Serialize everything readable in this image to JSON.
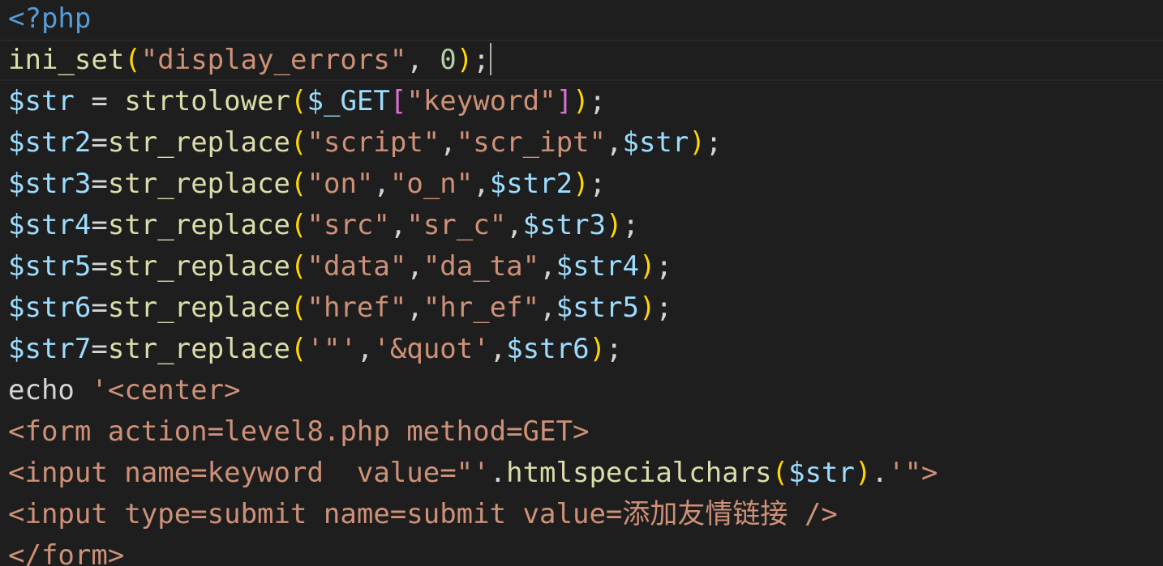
{
  "editor": {
    "colors": {
      "background": "#1e1e1e",
      "text": "#d4d4d4",
      "php_tag": "#569cd6",
      "function": "#dcdcaa",
      "variable": "#9cdcfe",
      "string": "#ce9178",
      "number": "#b5cea8",
      "bracket_gold": "#ffd700",
      "bracket_pink": "#da70d6",
      "current_line_border": "#282828",
      "cursor": "#aeafad"
    },
    "current_line_index": 1,
    "lines": [
      {
        "tokens": [
          {
            "t": "<?php",
            "c": "#569cd6"
          }
        ]
      },
      {
        "tokens": [
          {
            "t": "ini_set",
            "c": "#dcdcaa"
          },
          {
            "t": "(",
            "c": "#ffd700"
          },
          {
            "t": "\"display_errors\"",
            "c": "#ce9178"
          },
          {
            "t": ", ",
            "c": "#d4d4d4"
          },
          {
            "t": "0",
            "c": "#b5cea8"
          },
          {
            "t": ")",
            "c": "#ffd700"
          },
          {
            "t": ";",
            "c": "#d4d4d4"
          }
        ]
      },
      {
        "tokens": [
          {
            "t": "$str",
            "c": "#9cdcfe"
          },
          {
            "t": " = ",
            "c": "#d4d4d4"
          },
          {
            "t": "strtolower",
            "c": "#dcdcaa"
          },
          {
            "t": "(",
            "c": "#ffd700"
          },
          {
            "t": "$_GET",
            "c": "#9cdcfe"
          },
          {
            "t": "[",
            "c": "#da70d6"
          },
          {
            "t": "\"keyword\"",
            "c": "#ce9178"
          },
          {
            "t": "]",
            "c": "#da70d6"
          },
          {
            "t": ")",
            "c": "#ffd700"
          },
          {
            "t": ";",
            "c": "#d4d4d4"
          }
        ]
      },
      {
        "tokens": [
          {
            "t": "$str2",
            "c": "#9cdcfe"
          },
          {
            "t": "=",
            "c": "#d4d4d4"
          },
          {
            "t": "str_replace",
            "c": "#dcdcaa"
          },
          {
            "t": "(",
            "c": "#ffd700"
          },
          {
            "t": "\"script\"",
            "c": "#ce9178"
          },
          {
            "t": ",",
            "c": "#d4d4d4"
          },
          {
            "t": "\"scr_ipt\"",
            "c": "#ce9178"
          },
          {
            "t": ",",
            "c": "#d4d4d4"
          },
          {
            "t": "$str",
            "c": "#9cdcfe"
          },
          {
            "t": ")",
            "c": "#ffd700"
          },
          {
            "t": ";",
            "c": "#d4d4d4"
          }
        ]
      },
      {
        "tokens": [
          {
            "t": "$str3",
            "c": "#9cdcfe"
          },
          {
            "t": "=",
            "c": "#d4d4d4"
          },
          {
            "t": "str_replace",
            "c": "#dcdcaa"
          },
          {
            "t": "(",
            "c": "#ffd700"
          },
          {
            "t": "\"on\"",
            "c": "#ce9178"
          },
          {
            "t": ",",
            "c": "#d4d4d4"
          },
          {
            "t": "\"o_n\"",
            "c": "#ce9178"
          },
          {
            "t": ",",
            "c": "#d4d4d4"
          },
          {
            "t": "$str2",
            "c": "#9cdcfe"
          },
          {
            "t": ")",
            "c": "#ffd700"
          },
          {
            "t": ";",
            "c": "#d4d4d4"
          }
        ]
      },
      {
        "tokens": [
          {
            "t": "$str4",
            "c": "#9cdcfe"
          },
          {
            "t": "=",
            "c": "#d4d4d4"
          },
          {
            "t": "str_replace",
            "c": "#dcdcaa"
          },
          {
            "t": "(",
            "c": "#ffd700"
          },
          {
            "t": "\"src\"",
            "c": "#ce9178"
          },
          {
            "t": ",",
            "c": "#d4d4d4"
          },
          {
            "t": "\"sr_c\"",
            "c": "#ce9178"
          },
          {
            "t": ",",
            "c": "#d4d4d4"
          },
          {
            "t": "$str3",
            "c": "#9cdcfe"
          },
          {
            "t": ")",
            "c": "#ffd700"
          },
          {
            "t": ";",
            "c": "#d4d4d4"
          }
        ]
      },
      {
        "tokens": [
          {
            "t": "$str5",
            "c": "#9cdcfe"
          },
          {
            "t": "=",
            "c": "#d4d4d4"
          },
          {
            "t": "str_replace",
            "c": "#dcdcaa"
          },
          {
            "t": "(",
            "c": "#ffd700"
          },
          {
            "t": "\"data\"",
            "c": "#ce9178"
          },
          {
            "t": ",",
            "c": "#d4d4d4"
          },
          {
            "t": "\"da_ta\"",
            "c": "#ce9178"
          },
          {
            "t": ",",
            "c": "#d4d4d4"
          },
          {
            "t": "$str4",
            "c": "#9cdcfe"
          },
          {
            "t": ")",
            "c": "#ffd700"
          },
          {
            "t": ";",
            "c": "#d4d4d4"
          }
        ]
      },
      {
        "tokens": [
          {
            "t": "$str6",
            "c": "#9cdcfe"
          },
          {
            "t": "=",
            "c": "#d4d4d4"
          },
          {
            "t": "str_replace",
            "c": "#dcdcaa"
          },
          {
            "t": "(",
            "c": "#ffd700"
          },
          {
            "t": "\"href\"",
            "c": "#ce9178"
          },
          {
            "t": ",",
            "c": "#d4d4d4"
          },
          {
            "t": "\"hr_ef\"",
            "c": "#ce9178"
          },
          {
            "t": ",",
            "c": "#d4d4d4"
          },
          {
            "t": "$str5",
            "c": "#9cdcfe"
          },
          {
            "t": ")",
            "c": "#ffd700"
          },
          {
            "t": ";",
            "c": "#d4d4d4"
          }
        ]
      },
      {
        "tokens": [
          {
            "t": "$str7",
            "c": "#9cdcfe"
          },
          {
            "t": "=",
            "c": "#d4d4d4"
          },
          {
            "t": "str_replace",
            "c": "#dcdcaa"
          },
          {
            "t": "(",
            "c": "#ffd700"
          },
          {
            "t": "'\"'",
            "c": "#ce9178"
          },
          {
            "t": ",",
            "c": "#d4d4d4"
          },
          {
            "t": "'&quot'",
            "c": "#ce9178"
          },
          {
            "t": ",",
            "c": "#d4d4d4"
          },
          {
            "t": "$str6",
            "c": "#9cdcfe"
          },
          {
            "t": ")",
            "c": "#ffd700"
          },
          {
            "t": ";",
            "c": "#d4d4d4"
          }
        ]
      },
      {
        "tokens": [
          {
            "t": "echo",
            "c": "#d4d4d4"
          },
          {
            "t": " ",
            "c": "#d4d4d4"
          },
          {
            "t": "'<center>",
            "c": "#ce9178"
          }
        ]
      },
      {
        "tokens": [
          {
            "t": "<form action=level8.php method=GET>",
            "c": "#ce9178"
          }
        ]
      },
      {
        "tokens": [
          {
            "t": "<input name=keyword  value=\"'",
            "c": "#ce9178"
          },
          {
            "t": ".",
            "c": "#d4d4d4"
          },
          {
            "t": "htmlspecialchars",
            "c": "#dcdcaa"
          },
          {
            "t": "(",
            "c": "#ffd700"
          },
          {
            "t": "$str",
            "c": "#9cdcfe"
          },
          {
            "t": ")",
            "c": "#ffd700"
          },
          {
            "t": ".",
            "c": "#d4d4d4"
          },
          {
            "t": "'\">",
            "c": "#ce9178"
          }
        ]
      },
      {
        "tokens": [
          {
            "t": "<input type=submit name=submit value=添加友情链接 />",
            "c": "#ce9178"
          }
        ]
      },
      {
        "tokens": [
          {
            "t": "</form>",
            "c": "#ce9178"
          }
        ]
      }
    ]
  }
}
